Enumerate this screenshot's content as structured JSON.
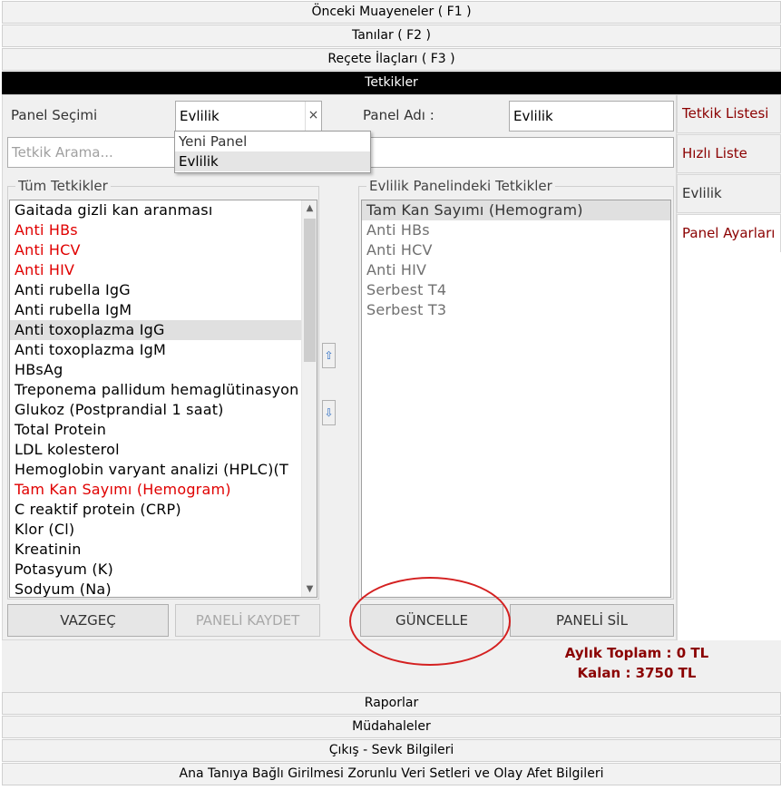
{
  "accordion_top": [
    "Önceki Muayeneler ( F1 )",
    "Tanılar ( F2 )",
    "Reçete İlaçları ( F3 )"
  ],
  "accordion_active": "Tetkikler",
  "form": {
    "panel_selection_label": "Panel Seçimi",
    "panel_selection_value": "Evlilik",
    "clear_glyph": "×",
    "panel_name_label": "Panel Adı :",
    "panel_name_value": "Evlilik",
    "search_placeholder": "Tetkik Arama..."
  },
  "dropdown_options": [
    "Yeni Panel",
    "Evlilik"
  ],
  "all_tests": {
    "title": "Tüm Tetkikler",
    "items": [
      {
        "label": "Gaitada gizli kan aranması",
        "color": "#000000"
      },
      {
        "label": "Anti HBs",
        "color": "#e00000"
      },
      {
        "label": "Anti HCV",
        "color": "#e00000"
      },
      {
        "label": "Anti HIV",
        "color": "#e00000"
      },
      {
        "label": "Anti rubella IgG",
        "color": "#000000"
      },
      {
        "label": "Anti rubella IgM",
        "color": "#000000"
      },
      {
        "label": "Anti toxoplazma IgG",
        "color": "#000000",
        "selected": true
      },
      {
        "label": "Anti toxoplazma IgM",
        "color": "#000000"
      },
      {
        "label": "HBsAg",
        "color": "#000000"
      },
      {
        "label": "Treponema pallidum hemaglütinasyon",
        "color": "#000000"
      },
      {
        "label": "Glukoz (Postprandial 1 saat)",
        "color": "#000000"
      },
      {
        "label": "Total Protein",
        "color": "#000000"
      },
      {
        "label": "LDL kolesterol",
        "color": "#000000"
      },
      {
        "label": "Hemoglobin varyant analizi (HPLC)(T",
        "color": "#000000"
      },
      {
        "label": "Tam Kan Sayımı (Hemogram)",
        "color": "#e00000"
      },
      {
        "label": "C reaktif protein (CRP)",
        "color": "#000000"
      },
      {
        "label": "Klor (Cl)",
        "color": "#000000"
      },
      {
        "label": "Kreatinin",
        "color": "#000000"
      },
      {
        "label": "Potasyum (K)",
        "color": "#000000"
      },
      {
        "label": "Sodyum (Na)",
        "color": "#000000"
      }
    ]
  },
  "panel_tests": {
    "title": "Evlilik Panelindeki Tetkikler",
    "items": [
      {
        "label": "Tam Kan Sayımı (Hemogram)",
        "color": "#333333",
        "selected": true
      },
      {
        "label": "Anti HBs",
        "color": "#707070"
      },
      {
        "label": "Anti HCV",
        "color": "#707070"
      },
      {
        "label": "Anti HIV",
        "color": "#707070"
      },
      {
        "label": "Serbest T4",
        "color": "#707070"
      },
      {
        "label": "Serbest T3",
        "color": "#707070"
      }
    ]
  },
  "buttons": {
    "cancel": "VAZGEÇ",
    "save_panel": "PANELİ KAYDET",
    "update": "GÜNCELLE",
    "delete_panel": "PANELİ SİL"
  },
  "tabs": [
    {
      "label": "Tetkik Listesi",
      "color": "#8b0000"
    },
    {
      "label": "Hızlı Liste",
      "color": "#8b0000"
    },
    {
      "label": "Evlilik",
      "color": "#333333"
    },
    {
      "label": "Panel Ayarları",
      "color": "#8b0000",
      "active": true
    }
  ],
  "totals": {
    "monthly_total": "Aylık Toplam : 0 TL",
    "remaining": "Kalan : 3750 TL"
  },
  "accordion_bottom": [
    "Raporlar",
    "Müdahaleler",
    "Çıkış - Sevk Bilgileri",
    "Ana Tanıya Bağlı Girilmesi Zorunlu Veri Setleri ve Olay Afet Bilgileri"
  ],
  "colors": {
    "accent_dark_red": "#8b0000",
    "highlight_red": "#e00000",
    "annotation_circle": "#d42020"
  },
  "icons": {
    "move_up": "arrow-up-icon",
    "move_down": "arrow-down-icon",
    "scroll_up": "chevron-up-icon",
    "scroll_down": "chevron-down-icon"
  }
}
